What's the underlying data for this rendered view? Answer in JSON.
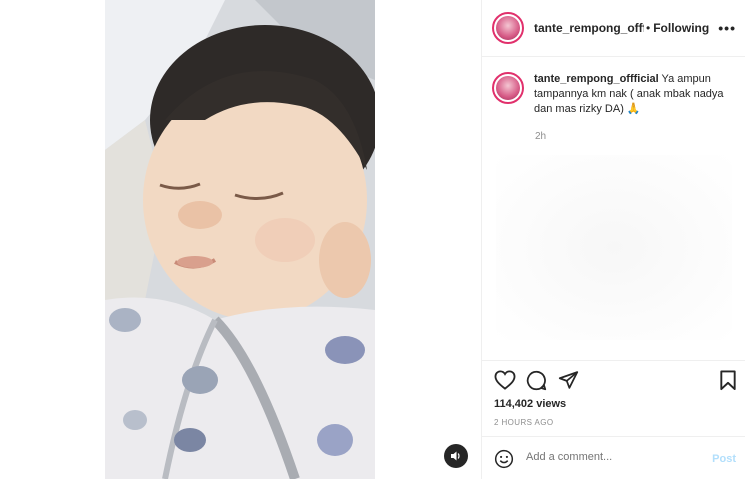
{
  "post": {
    "username": "tante_rempong_offficial",
    "separator": "•",
    "follow_status": "Following",
    "more_label": "•••"
  },
  "caption": {
    "username": "tante_rempong_offficial",
    "text": "Ya ampun tampannya km nak ( anak mbak nadya dan mas rizky DA) 🙏",
    "time": "2h"
  },
  "icons": {
    "like": "heart-icon",
    "comment": "comment-icon",
    "share": "paper-plane-icon",
    "save": "bookmark-icon",
    "sound": "speaker-icon",
    "emoji": "smiley-icon"
  },
  "stats": {
    "views": "114,402 views",
    "posted": "2 HOURS AGO"
  },
  "comment_box": {
    "placeholder": "Add a comment...",
    "post_label": "Post"
  },
  "colors": {
    "story_ring": "#e1306c",
    "post_disabled": "#b2dffc",
    "muted_text": "#8e8e8e"
  }
}
